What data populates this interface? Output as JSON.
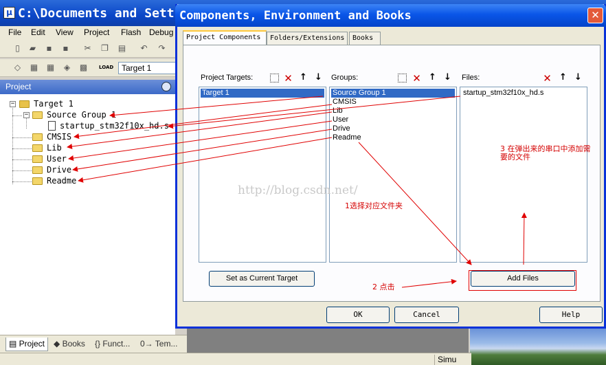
{
  "window": {
    "title": "C:\\Documents and Sett"
  },
  "menu": [
    "File",
    "Edit",
    "View",
    "Project",
    "Flash",
    "Debug"
  ],
  "toolbar": {
    "target_combo": "Target 1",
    "load_label": "LOAD"
  },
  "project_panel": {
    "header": "Project",
    "tree": [
      {
        "label": "Target 1"
      },
      {
        "label": "Source Group 1"
      },
      {
        "label": "startup_stm32f10x_hd.s"
      },
      {
        "label": "CMSIS"
      },
      {
        "label": "Lib"
      },
      {
        "label": "User"
      },
      {
        "label": "Drive"
      },
      {
        "label": "Readme"
      }
    ]
  },
  "bottom_tabs": [
    "Project",
    "Books",
    "{} Funct...",
    "0→ Tem..."
  ],
  "status": {
    "right_cell": "Simu"
  },
  "dialog": {
    "title": "Components, Environment and Books",
    "close_glyph": "✕",
    "tabs": [
      "Project Components",
      "Folders/Extensions",
      "Books"
    ],
    "targets": {
      "caption": "Project Targets:",
      "items": [
        "Target 1"
      ]
    },
    "groups": {
      "caption": "Groups:",
      "items": [
        "Source Group 1",
        "CMSIS",
        "Lib",
        "User",
        "Drive",
        "Readme"
      ]
    },
    "files": {
      "caption": "Files:",
      "items": [
        "startup_stm32f10x_hd.s"
      ]
    },
    "set_current_target": "Set as Current Target",
    "add_files": "Add Files",
    "ok": "OK",
    "cancel": "Cancel",
    "help": "Help"
  },
  "annotations": {
    "step1": "1选择对应文件夹",
    "step2": "2 点击",
    "step3_line1": "3 在弹出来的串口中添加需",
    "step3_line2": "要的文件",
    "watermark": "http://blog.csdn.net/",
    "arrow_color": "#e00000"
  }
}
